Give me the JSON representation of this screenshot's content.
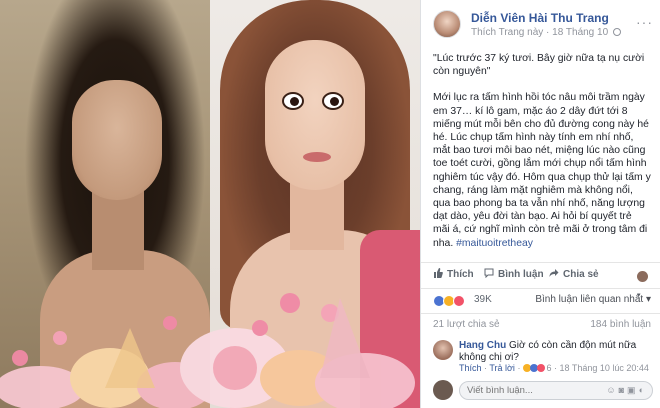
{
  "post": {
    "page_name": "Diễn Viên Hài Thu Trang",
    "like_page": "Thích Trang này",
    "separator": "·",
    "date": "18 Tháng 10",
    "more": "···",
    "quote": "\"Lúc trước 37 ký tươi. Bây giờ nữa tạ nụ cười còn nguyên\"",
    "body": "Mới lục ra tấm hình hồi tóc nâu môi trầm ngày em 37… kí lô gam, mặc áo 2 dây đứt tới 8 miếng mút mỗi bên cho đủ đường cong này hé hé. Lúc chụp tấm hình này tính em nhí nhố, mắt bao tươi môi bao nét, miệng lúc nào cũng toe toét cười, gồng lắm mới chụp nổi tấm hình nghiêm túc vậy đó. Hôm qua chụp thử lại tấm y chang, ráng làm mặt nghiêm mà không nổi, qua bao phong ba ta vẫn nhí nhố, năng lượng dạt dào, yêu đời tàn bạo. Ai hỏi bí quyết trẻ mãi á, cứ nghĩ mình còn trẻ mãi ở trong tâm đi nha.",
    "hashtag": "#maituoitretheay"
  },
  "actions": {
    "like": "Thích",
    "comment": "Bình luận",
    "share": "Chia sẻ"
  },
  "reactions": {
    "count": "39K",
    "sort": "Bình luận liên quan nhất ▾"
  },
  "stats": {
    "shares": "21 lượt chia sẻ",
    "comments": "184 bình luận"
  },
  "comment": {
    "author": "Hang Chu",
    "text": "Giờ có còn cần độn mút nữa không chị ơi?",
    "like": "Thích",
    "reply": "Trả lời",
    "reaction_count": "6",
    "time": "18 Tháng 10 lúc 20:44"
  },
  "compose": {
    "placeholder": "Viết bình luận..."
  },
  "colors": {
    "link": "#365899",
    "secondary": "#90949c",
    "like_blue": "#4b73d1",
    "haha_yellow": "#f7b125",
    "love_red": "#f25268"
  }
}
